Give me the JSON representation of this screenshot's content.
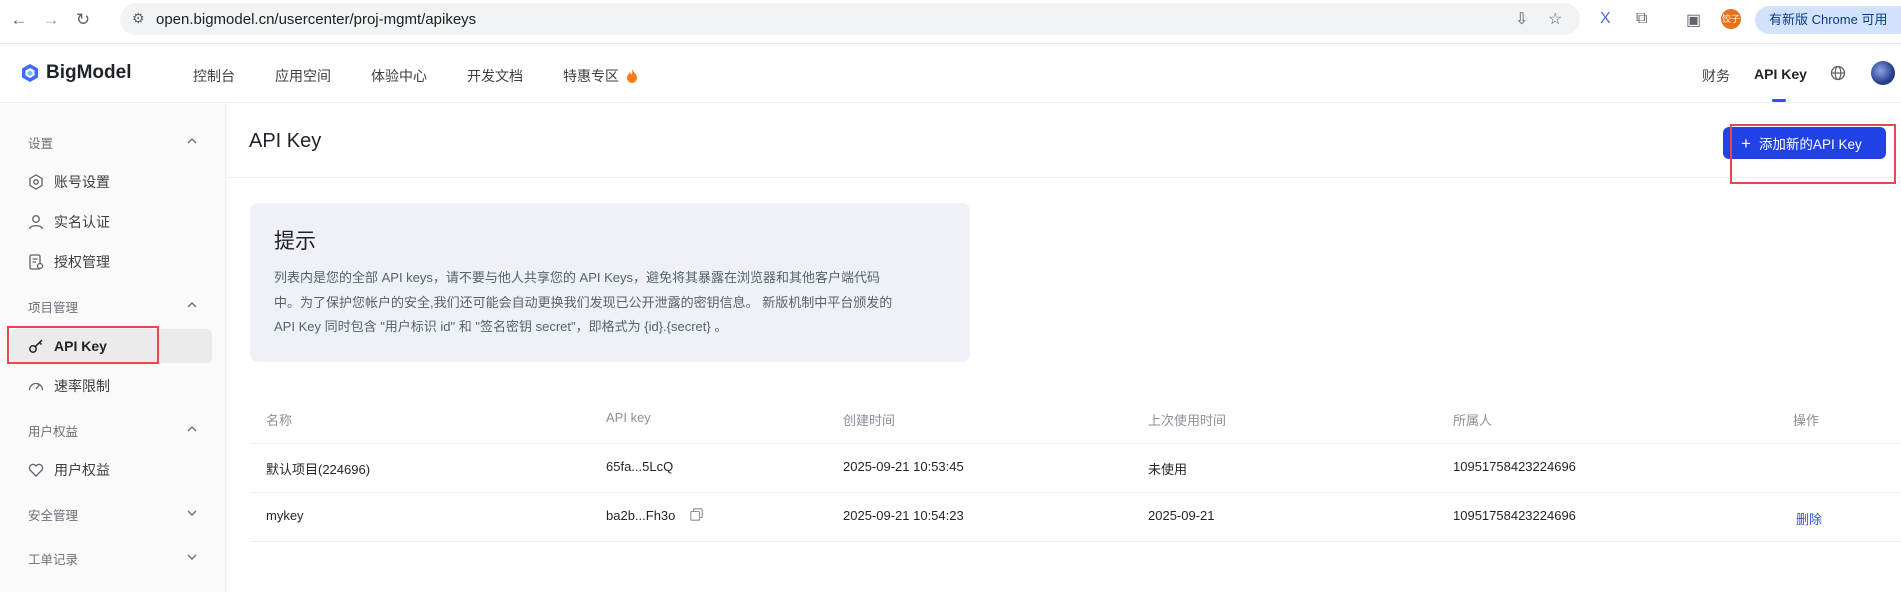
{
  "browser": {
    "url": "open.bigmodel.cn/usercenter/proj-mgmt/apikeys",
    "profile_badge": "饺子",
    "update_label": "有新版 Chrome 可用"
  },
  "header": {
    "brand": "BigModel",
    "nav": [
      "控制台",
      "应用空间",
      "体验中心",
      "开发文档",
      "特惠专区"
    ],
    "right": {
      "finance": "财务",
      "apikey": "API Key"
    }
  },
  "sidebar": {
    "groups": {
      "settings": "设置",
      "project": "项目管理",
      "rights": "用户权益",
      "security": "安全管理",
      "tickets": "工单记录"
    },
    "items": {
      "account": "账号设置",
      "realname": "实名认证",
      "auth": "授权管理",
      "apikey": "API Key",
      "rate": "速率限制",
      "user_rights": "用户权益"
    }
  },
  "main": {
    "title": "API Key",
    "add_button": "添加新的API Key",
    "tip": {
      "title": "提示",
      "line1": "列表内是您的全部 API keys，请不要与他人共享您的 API Keys，避免将其暴露在浏览器和其他客户端代码",
      "line2": "中。为了保护您帐户的安全,我们还可能会自动更换我们发现已公开泄露的密钥信息。 新版机制中平台颁发的",
      "line3": "API Key 同时包含 \"用户标识 id\" 和 \"签名密钥 secret\"，即格式为 {id}.{secret} 。"
    },
    "table": {
      "columns": [
        "名称",
        "API key",
        "创建时间",
        "上次使用时间",
        "所属人",
        "操作"
      ],
      "rows": [
        {
          "name": "默认项目(224696)",
          "key": "65fa...5LcQ",
          "created": "2025-09-21 10:53:45",
          "last_used": "未使用",
          "owner": "10951758423224696",
          "action": ""
        },
        {
          "name": "mykey",
          "key": "ba2b...Fh3o",
          "created": "2025-09-21 10:54:23",
          "last_used": "2025-09-21",
          "owner": "10951758423224696",
          "action": "删除"
        }
      ]
    }
  },
  "colors": {
    "accent": "#2142e6",
    "highlight_box": "#e5484d",
    "tip_bg": "#eef1f8"
  }
}
